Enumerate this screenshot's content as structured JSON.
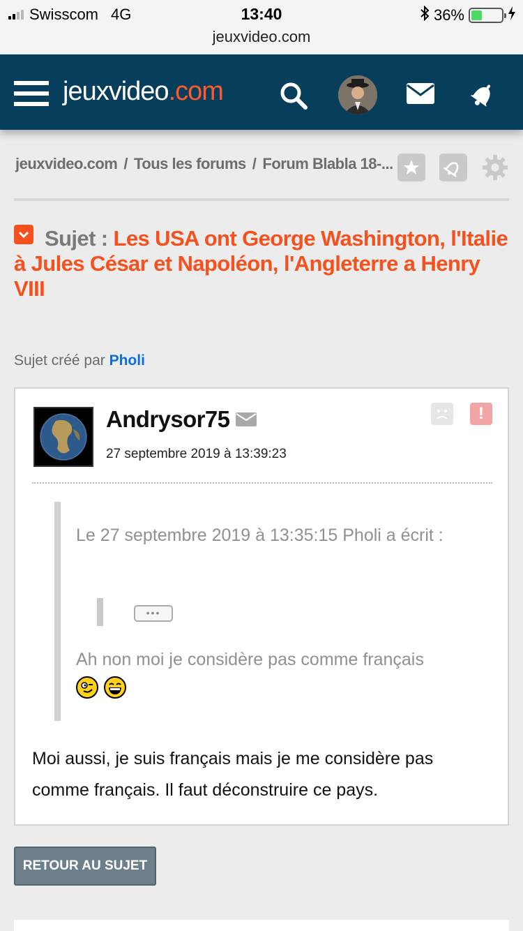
{
  "status_bar": {
    "carrier": "Swisscom",
    "network": "4G",
    "time": "13:40",
    "url": "jeuxvideo.com",
    "battery": "36%",
    "battery_level": 0.36
  },
  "header": {
    "logo_main": "jeuxvideo",
    "logo_accent": ".com",
    "icons": [
      "menu-icon",
      "search-icon",
      "avatar",
      "mail-icon",
      "bell-icon"
    ]
  },
  "breadcrumb": {
    "items": [
      "jeuxvideo.com",
      "Tous les forums",
      "Forum Blabla 18-..."
    ],
    "separator": "/"
  },
  "topic": {
    "label": "Sujet :",
    "title": "Les USA ont George Washington, l'Italie à Jules César et Napoléon, l'Angleterre a Henry VIII",
    "created_by_prefix": "Sujet créé par",
    "created_by": "Pholi"
  },
  "post": {
    "author": "Andrysor75",
    "date": "27 septembre 2019 à 13:39:23",
    "quote_header": "Le 27 septembre 2019 à 13:35:15 Pholi a écrit :",
    "quote_expand": "•••",
    "quote_text": "Ah non moi je considère pas comme français",
    "body": "Moi aussi, je suis français mais je me considère pas comme français. Il faut déconstruire ce pays.",
    "alert_symbol": "!"
  },
  "actions": {
    "back_button": "RETOUR AU SUJET"
  },
  "colors": {
    "header_bg": "#073e5c",
    "accent": "#f4511e",
    "link": "#0a6fd6"
  }
}
